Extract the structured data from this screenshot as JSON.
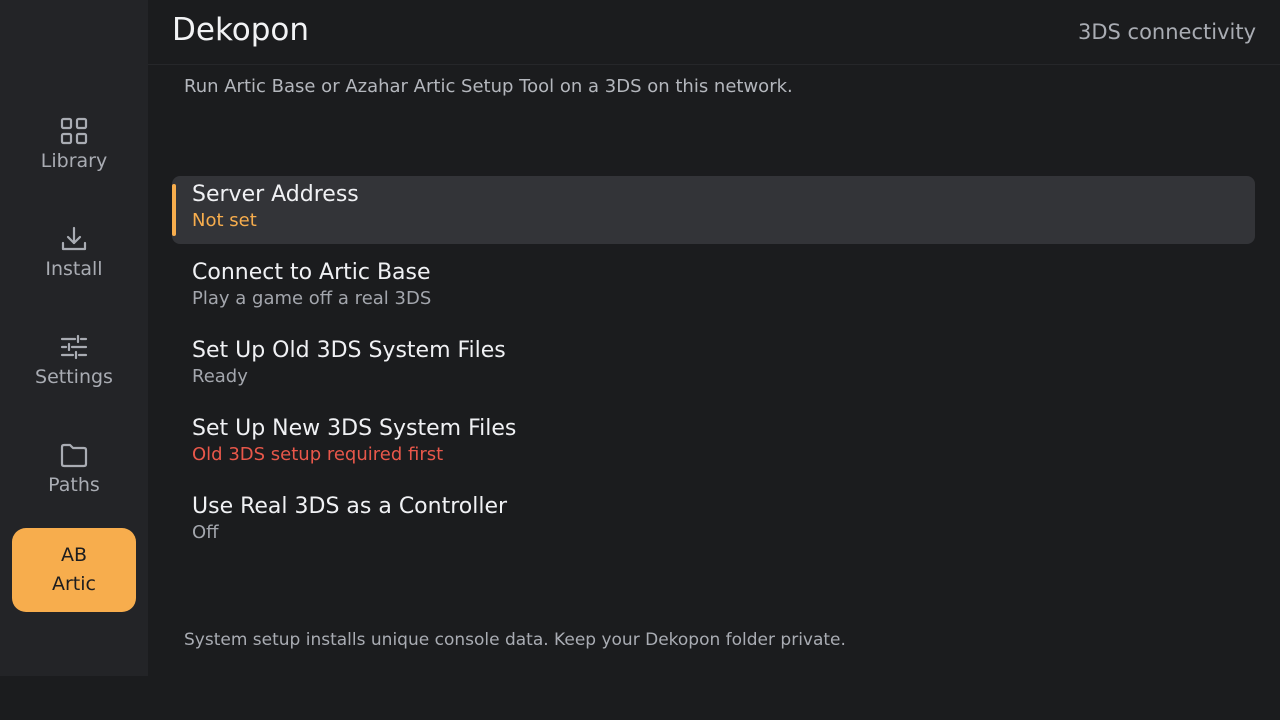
{
  "app": {
    "title": "Dekopon",
    "section": "3DS connectivity"
  },
  "sidebar": {
    "items": [
      {
        "label": "Library",
        "icon": "grid-icon"
      },
      {
        "label": "Install",
        "icon": "download-icon"
      },
      {
        "label": "Settings",
        "icon": "sliders-icon"
      },
      {
        "label": "Paths",
        "icon": "folder-icon"
      },
      {
        "label": "Artic",
        "badge": "AB",
        "active": true
      }
    ]
  },
  "main": {
    "hint": "Run Artic Base or Azahar Artic Setup Tool on a 3DS on this network.",
    "options": [
      {
        "title": "Server Address",
        "subtitle": "Not set",
        "status": "warning",
        "selected": true
      },
      {
        "title": "Connect to Artic Base",
        "subtitle": "Play a game off a real 3DS",
        "status": "normal"
      },
      {
        "title": "Set Up Old 3DS System Files",
        "subtitle": "Ready",
        "status": "normal"
      },
      {
        "title": "Set Up New 3DS System Files",
        "subtitle": "Old 3DS setup required first",
        "status": "error"
      },
      {
        "title": "Use Real 3DS as a Controller",
        "subtitle": "Off",
        "status": "normal"
      }
    ],
    "footer_note": "System setup installs unique console data. Keep your Dekopon folder private."
  },
  "colors": {
    "accent": "#f7ad4d",
    "error": "#e8574a",
    "background": "#1b1c1e",
    "sidebar": "#232427",
    "selected_row": "#333438"
  }
}
